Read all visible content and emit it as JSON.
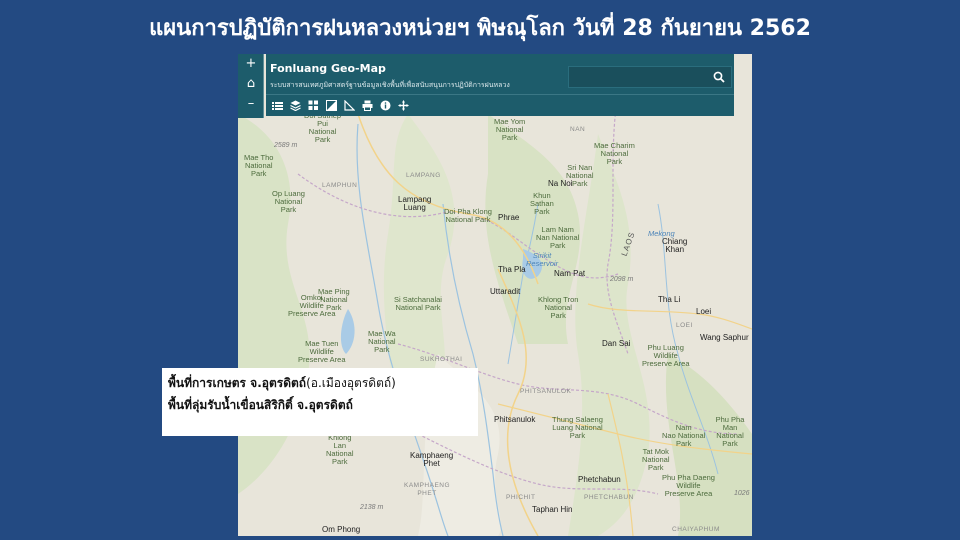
{
  "slide": {
    "title": "แผนการปฏิบัติการฝนหลวงหน่วยฯ พิษณุโลก วันที่ 28 กันยายน 2562"
  },
  "map_app": {
    "title": "Fonluang Geo-Map",
    "subtitle": "ระบบสารสนเทศภูมิศาสตร์ฐานข้อมูลเชิงพื้นที่เพื่อสนับสนุนการปฏิบัติการฝนหลวง",
    "zoom_in": "+",
    "home": "⌂",
    "zoom_out": "–",
    "search": {
      "value": "",
      "placeholder": ""
    },
    "toolbar_icons": [
      "list-icon",
      "layers-icon",
      "basemap-icon",
      "contrast-icon",
      "measure-icon",
      "print-icon",
      "info-icon",
      "navigate-icon"
    ],
    "accent": "#1d5c6b"
  },
  "map_labels": {
    "doi_suthep": "Doi Suthep\nPui\nNational\nPark",
    "mae_tho": "Mae Tho\nNational\nPark",
    "op_luang": "Op Luang\nNational\nPark",
    "lampang_region": "LAMPANG",
    "lamphun": "LAMPHUN",
    "lampang_city": "Lampang\nLuang",
    "doi_pha_klong": "Doi Pha Klong\nNational Park",
    "phrae": "Phrae",
    "mae_yom": "Mae Yom\nNational\nPark",
    "nan_region": "NAN",
    "mae_charim": "Mae Charim\nNational\nPark",
    "na_noi": "Na Noi",
    "sri_nan": "Sri Nan\nNational\nPark",
    "khun_sathan": "Khun\nSathan\nPark",
    "lam_nam_nan": "Lam Nam\nNan National\nPark",
    "sirikit": "Sirikit\nReservoir",
    "tha_pla": "Tha Pla",
    "nam_pat": "Nam Pat",
    "uttaradit": "Uttaradit",
    "khlong_tron": "Khlong Tron\nNational\nPark",
    "laos": "LAOS",
    "chiang_khan": "Chiang\nKhan",
    "mekong": "Mekong",
    "tha_li": "Tha Li",
    "loei_region": "LOEI",
    "loei": "Loei",
    "wang_saphung": "Wang Saphur",
    "dan_sai": "Dan Sai",
    "phu_luang": "Phu Luang\nWildlife\nPreserve Area",
    "mae_ping": "Mae Ping\nNational\nPark",
    "om_koi": "Omkoi\nWildlife\nPreserve Area",
    "si_satchanalai": "Si Satchanalai\nNational Park",
    "mae_wa": "Mae Wa\nNational\nPark",
    "mae_tuen": "Mae Tuen\nWildlife\nPreserve Area",
    "sukhothai_region": "SUKHOTHAI",
    "phitsanulok_region": "PHITSANULOK",
    "phitsanulok": "Phitsanulok",
    "thung_salaeng": "Thung Salaeng\nLuang National\nPark",
    "nam_nao": "Nam\nNao National\nPark",
    "phu_pha_man": "Phu Pha Man\nNational\nPark",
    "tat_mok": "Tat Mok\nNational\nPark",
    "phu_pha_daeng": "Phu Pha Daeng\nWildlife\nPreserve Area",
    "kamphaeng_phet": "Kamphaeng\nPhet",
    "kamphaeng_region": "KAMPHAENG\nPHET",
    "khlong_lan": "Khlong\nLan\nNational\nPark",
    "phichit": "PHICHIT",
    "phetchabun": "Phetchabun",
    "phetchabun_region": "PHETCHABUN",
    "taphan_hin": "Taphan Hin",
    "chaiyaphum": "CHAIYAPHUM",
    "om_phong": "Om Phong",
    "elev_2589": "2589 m",
    "elev_2098": "2098 m",
    "elev_2138": "2138 m",
    "elev_1026": "1026"
  },
  "legend": {
    "line1_bold": "พื้นที่การเกษตร จ.อุตรดิตถ์",
    "line1_normal": "(อ.เมืองอุตรดิตถ์)",
    "line2": "พื้นที่ลุ่มรับน้ำเขื่อนสิริกิติ์ จ.อุตรดิตถ์"
  }
}
